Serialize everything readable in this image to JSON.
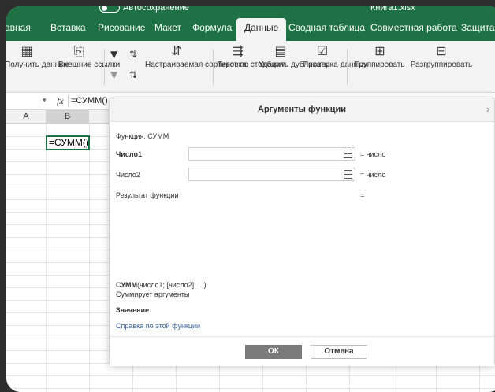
{
  "titlebar": {
    "autosave": "Автосохранение",
    "filename": "Книга1.xlsx"
  },
  "tabs": [
    "авная",
    "Вставка",
    "Рисование",
    "Макет",
    "Формула",
    "Данные",
    "Сводная таблица",
    "Совместная работа",
    "Защита"
  ],
  "active_tab": "Данные",
  "ribbon": {
    "get_data": "Получить данные",
    "external_links": "Внешние ссылки",
    "custom_sort": "Настраиваемая сортировка",
    "text_to_columns": "Текст по столбцам",
    "remove_duplicates": "Удалить дубликаты",
    "data_validation": "Проверка данных",
    "group": "Группировать",
    "ungroup": "Разгруппировать"
  },
  "formula_bar": {
    "fx": "fx",
    "text": "=СУММ()"
  },
  "columns": [
    "A",
    "B"
  ],
  "cell_b3": "=СУММ()",
  "dialog": {
    "title": "Аргументы функции",
    "function_label": "Функция: СУММ",
    "arg1_label": "Число1",
    "arg2_label": "Число2",
    "arg1_hint": "= число",
    "arg2_hint": "= число",
    "result_label": "Результат функции",
    "result_value": "=",
    "syntax_name": "СУММ",
    "syntax_args": "(число1; [число2]; ...)",
    "description": "Суммирует аргументы",
    "value_label": "Значение:",
    "help_link": "Справка по этой функции",
    "ok": "ОК",
    "cancel": "Отмена"
  },
  "colors": {
    "accent": "#1e7145",
    "ok_button": "#7a7a7a",
    "link": "#2f5e9e"
  }
}
